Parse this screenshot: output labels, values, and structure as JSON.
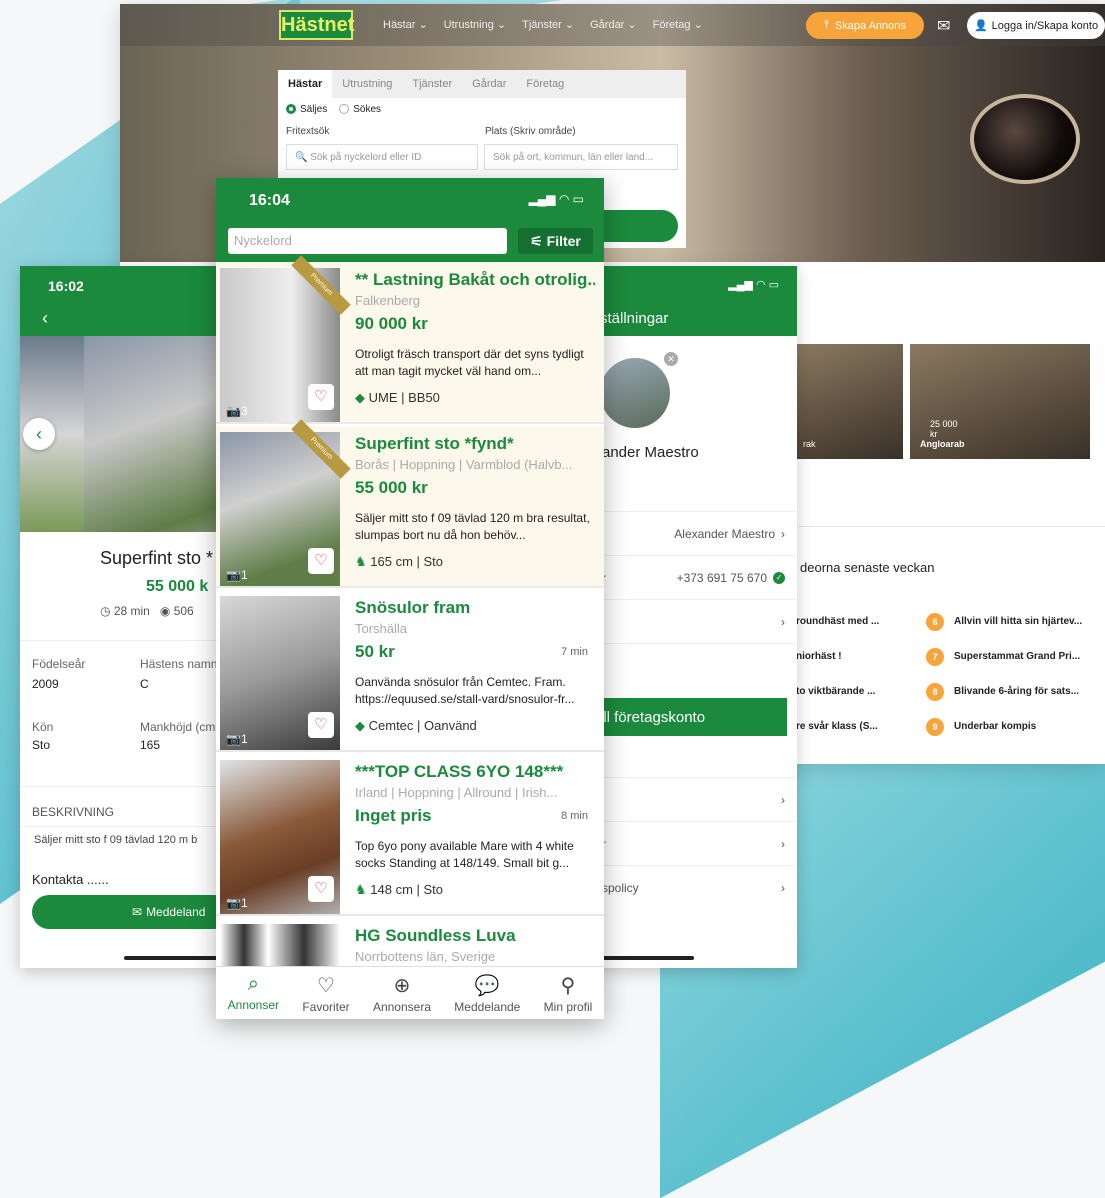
{
  "desktop": {
    "logo": "Hästnet",
    "nav": [
      "Hästar ⌄",
      "Utrustning ⌄",
      "Tjänster ⌄",
      "Gårdar ⌄",
      "Företag ⌄"
    ],
    "create_ad": "Skapa Annons",
    "login": "Logga in/Skapa konto",
    "search_tabs": [
      "Hästar",
      "Utrustning",
      "Tjänster",
      "Gårdar",
      "Företag"
    ],
    "radio_sell": "Säljes",
    "radio_seek": "Sökes",
    "freetext_label": "Fritextsök",
    "place_label": "Plats (Skriv område)",
    "freetext_placeholder": "Sök på nyckelord eller ID",
    "place_placeholder": "Sök på ort, kommun, län eller land...",
    "thumbs": [
      {
        "label": "rak",
        "price": ""
      },
      {
        "label": "Angloarab",
        "price": "25 000 kr"
      }
    ],
    "popular_title": "deorna senaste veckan",
    "popular_left": [
      "roundhäst med ...",
      "niorhäst !",
      "to viktbärande ...",
      "re svår klass (S..."
    ],
    "popular_right": [
      {
        "n": "6",
        "t": "Allvin vill hitta sin hjärtev..."
      },
      {
        "n": "7",
        "t": "Superstammat Grand Pri..."
      },
      {
        "n": "8",
        "t": "Blivande 6-åring för sats..."
      },
      {
        "n": "9",
        "t": "Underbar kompis"
      }
    ]
  },
  "left_phone": {
    "time": "16:02",
    "title": "Superfint sto *",
    "price": "55 000 k",
    "age": "28 min",
    "views": "506",
    "fields": [
      {
        "label": "Födelseår",
        "value": "2009"
      },
      {
        "label": "Hästens namn",
        "value": "C"
      },
      {
        "label": "Kön",
        "value": "Sto"
      },
      {
        "label": "Mankhöjd (cm",
        "value": "165"
      }
    ],
    "desc_header": "BESKRIVNING",
    "desc_text": "Säljer mitt sto f 09 tävlad 120 m b",
    "contact": "Kontakta ......",
    "message_btn": "Meddeland"
  },
  "right_phone": {
    "header": "ställningar",
    "name": "ander Maestro",
    "rows": [
      {
        "left": "",
        "right": "Alexander Maestro"
      },
      {
        "left": "r",
        "right": "+373 691 75 670"
      },
      {
        "left": "",
        "right": ""
      }
    ],
    "company_btn": "ill företagskonto",
    "rows2": [
      "",
      "r",
      "spolicy"
    ]
  },
  "center_phone": {
    "time": "16:04",
    "search_placeholder": "Nyckelord",
    "filter": "Filter",
    "premium": "Premium",
    "listings": [
      {
        "title": "** Lastning Bakåt och otrolig...",
        "loc": "Falkenberg",
        "price": "90 000 kr",
        "ago": "",
        "desc": "Otroligt fräsch transport där det syns tydligt att man tagit mycket väl hand om...",
        "tags": "UME | BB50",
        "photos": "3",
        "premium": true
      },
      {
        "title": "Superfint sto *fynd*",
        "loc": "Borås | Hoppning | Varmblod (Halvb...",
        "price": "55 000 kr",
        "ago": "",
        "desc": "Säljer mitt sto f 09 tävlad 120 m bra resultat, slumpas bort nu då hon behöv...",
        "tags": "165 cm | Sto",
        "photos": "1",
        "premium": true
      },
      {
        "title": "Snösulor fram",
        "loc": "Torshälla",
        "price": "50 kr",
        "ago": "7 min",
        "desc": "Oanvända snösulor från Cemtec. Fram. https://equused.se/stall-vard/snosulor-fr...",
        "tags": "Cemtec | Oanvänd",
        "photos": "1",
        "premium": false
      },
      {
        "title": "***TOP CLASS 6YO 148***",
        "loc": "Irland | Hoppning | Allround | Irish...",
        "price": "Inget pris",
        "ago": "8 min",
        "desc": "Top 6yo pony available Mare with 4 white socks  Standing at 148/149. Small bit g...",
        "tags": "148 cm | Sto",
        "photos": "1",
        "premium": false
      },
      {
        "title": "HG Soundless Luva",
        "loc": "Norrbottens län,  Sverige",
        "price": "",
        "ago": "",
        "desc": "",
        "tags": "",
        "photos": "",
        "premium": false
      }
    ],
    "tabs": [
      "Annonser",
      "Favoriter",
      "Annonsera",
      "Meddelande",
      "Min profil"
    ]
  },
  "colors": {
    "brand_green": "#1b8a3c",
    "accent_orange": "#f7a53a",
    "heart_red": "#e0343c"
  }
}
